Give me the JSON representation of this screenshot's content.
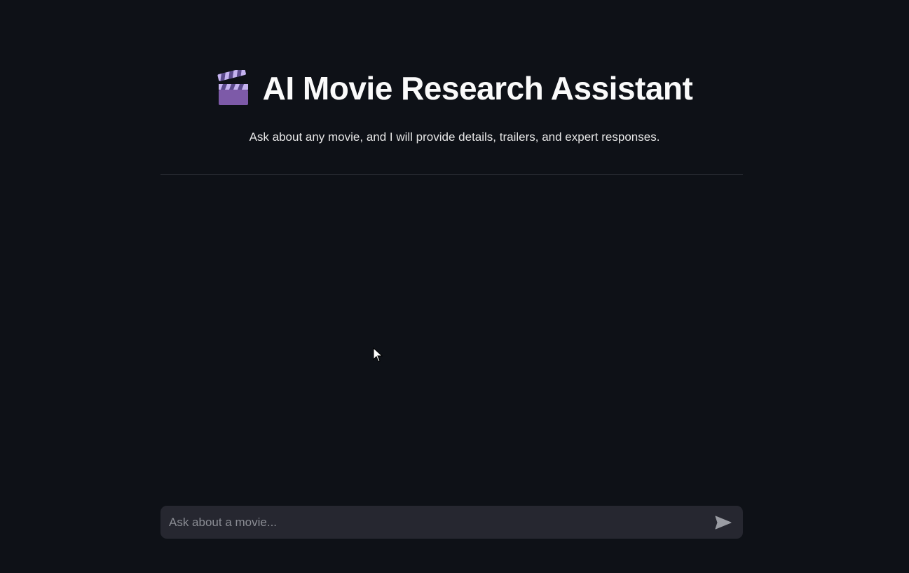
{
  "header": {
    "title": "AI Movie Research Assistant",
    "icon": "clapper-board-icon",
    "subtitle": "Ask about any movie, and I will provide details, trailers, and expert responses."
  },
  "chat": {
    "placeholder": "Ask about a movie...",
    "value": "",
    "send_icon": "send-icon"
  },
  "colors": {
    "background": "#0e1117",
    "input_background": "#262730",
    "divider": "#31333b",
    "text": "#fafafa"
  }
}
